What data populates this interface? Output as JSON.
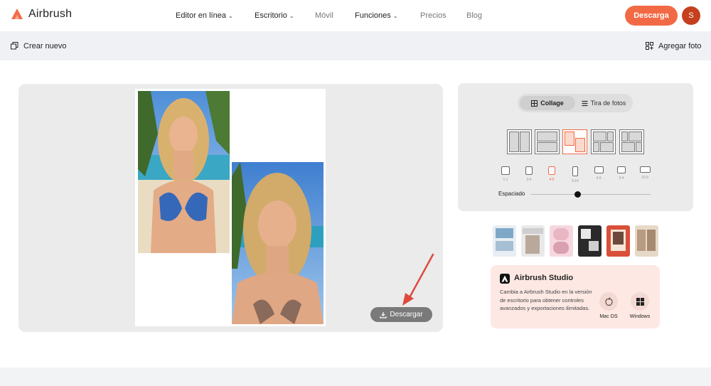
{
  "header": {
    "brand": "Airbrush",
    "nav": [
      {
        "label": "Editor en línea",
        "has_menu": true
      },
      {
        "label": "Escritorio",
        "has_menu": true
      },
      {
        "label": "Móvil",
        "has_menu": false
      },
      {
        "label": "Funciones",
        "has_menu": true
      },
      {
        "label": "Precios",
        "has_menu": false
      },
      {
        "label": "Blog",
        "has_menu": false
      }
    ],
    "download_label": "Descarga",
    "avatar_initial": "S"
  },
  "toolbar": {
    "create_new_label": "Crear nuevo",
    "add_photo_label": "Agregar foto"
  },
  "canvas": {
    "download_label": "Descargar"
  },
  "panel": {
    "tabs": [
      {
        "label": "Collage",
        "active": true,
        "icon": "grid-icon"
      },
      {
        "label": "Tira de fotos",
        "active": false,
        "icon": "strip-icon"
      }
    ],
    "selected_layout_index": 2,
    "ratios": [
      "1:1",
      "3:4",
      "4:5",
      "9:16",
      "4:3",
      "5:4",
      "16:9"
    ],
    "selected_ratio": "4:5",
    "spacing_label": "Espaciado",
    "spacing_value": 0.36
  },
  "studio": {
    "title": "Airbrush Studio",
    "description": "Cambia a Airbrush Studio en la versión de escritorio para obtener controles avanzados y exportaciones ilimitadas.",
    "os": [
      {
        "label": "Mac OS",
        "icon": "apple-icon"
      },
      {
        "label": "Windows",
        "icon": "windows-icon"
      }
    ]
  },
  "colors": {
    "accent": "#f26a45",
    "toolbar_bg": "#eff1f5",
    "panel_bg": "#ebebeb",
    "studio_bg": "#fde8e3"
  }
}
